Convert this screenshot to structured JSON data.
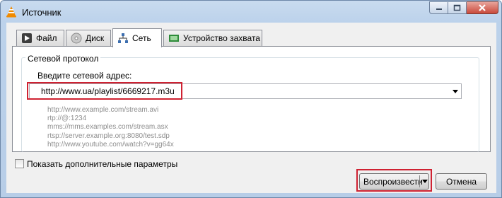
{
  "window": {
    "title": "Источник"
  },
  "tabs": [
    {
      "label": "Файл",
      "icon": "file-play-icon"
    },
    {
      "label": "Диск",
      "icon": "disc-icon"
    },
    {
      "label": "Сеть",
      "icon": "network-icon"
    },
    {
      "label": "Устройство захвата",
      "icon": "capture-device-icon"
    }
  ],
  "active_tab": "Сеть",
  "network": {
    "group_title": "Сетевой протокол",
    "address_label": "Введите сетевой адрес:",
    "address_value": "http://www.ua/playlist/6669217.m3u",
    "examples": [
      "http://www.example.com/stream.avi",
      "rtp://@:1234",
      "mms://mms.examples.com/stream.asx",
      "rtsp://server.example.org:8080/test.sdp",
      "http://www.youtube.com/watch?v=gg64x"
    ]
  },
  "options": {
    "show_more_label": "Показать дополнительные параметры",
    "show_more_checked": false
  },
  "buttons": {
    "play_label": "Воспроизвести",
    "cancel_label": "Отмена"
  },
  "colors": {
    "highlight": "#cf2232",
    "title_bar": "#bcd2eb"
  }
}
